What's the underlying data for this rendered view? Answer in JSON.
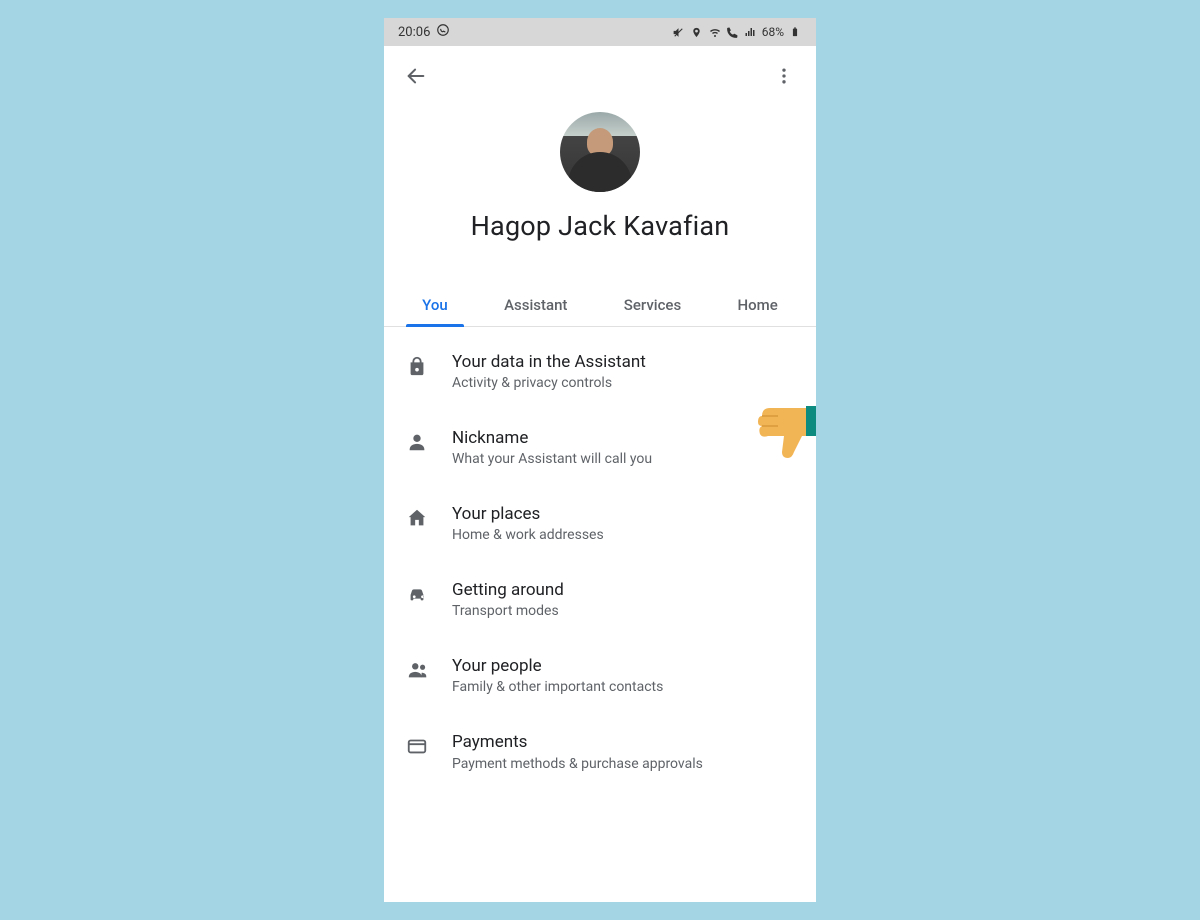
{
  "statusbar": {
    "time": "20:06",
    "battery": "68%"
  },
  "profile": {
    "name": "Hagop Jack Kavafian"
  },
  "tabs": [
    {
      "label": "You",
      "active": true
    },
    {
      "label": "Assistant",
      "active": false
    },
    {
      "label": "Services",
      "active": false
    },
    {
      "label": "Home",
      "active": false
    }
  ],
  "list": [
    {
      "icon": "lock",
      "title": "Your data in the Assistant",
      "sub": "Activity & privacy controls"
    },
    {
      "icon": "person",
      "title": "Nickname",
      "sub": "What your Assistant will call you"
    },
    {
      "icon": "home",
      "title": "Your places",
      "sub": "Home & work addresses"
    },
    {
      "icon": "car",
      "title": "Getting around",
      "sub": "Transport modes"
    },
    {
      "icon": "people",
      "title": "Your people",
      "sub": "Family & other important contacts"
    },
    {
      "icon": "card",
      "title": "Payments",
      "sub": "Payment methods & purchase approvals"
    }
  ]
}
